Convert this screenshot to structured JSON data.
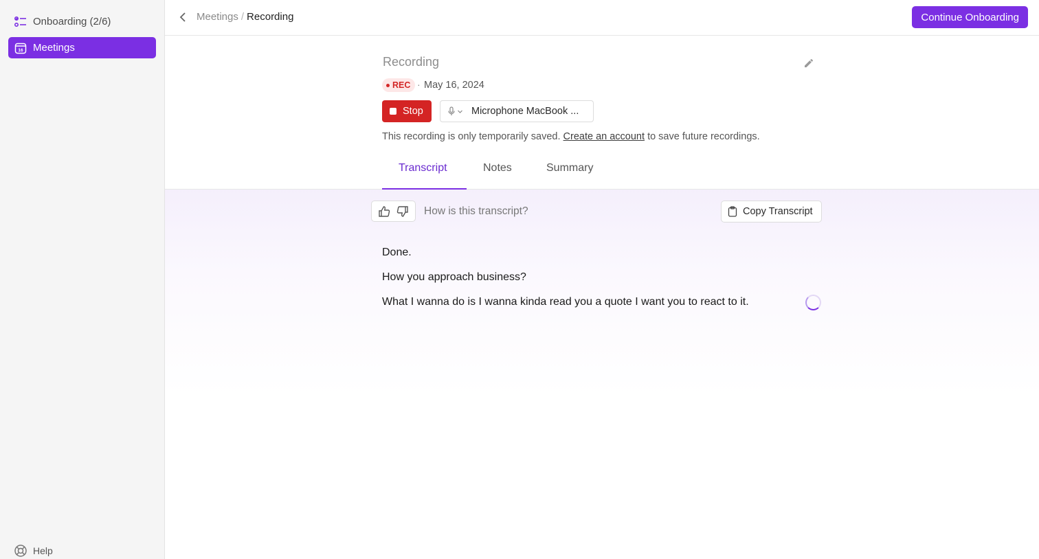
{
  "sidebar": {
    "items": [
      {
        "label": "Onboarding (2/6)",
        "icon": "checklist-icon"
      },
      {
        "label": "Meetings",
        "icon": "calendar-icon",
        "active": true
      }
    ],
    "calendar_day": "16",
    "help_label": "Help"
  },
  "topbar": {
    "breadcrumb_parent": "Meetings",
    "breadcrumb_sep": "/",
    "breadcrumb_current": "Recording",
    "continue_label": "Continue Onboarding"
  },
  "recording": {
    "title": "Recording",
    "badge": "REC",
    "meta_sep": "·",
    "date": "May 16, 2024",
    "stop_label": "Stop",
    "microphone": "Microphone MacBook ...",
    "notice_prefix": "This recording is only temporarily saved.",
    "notice_link": "Create an account",
    "notice_suffix": "to save future recordings."
  },
  "tabs": [
    {
      "label": "Transcript",
      "active": true
    },
    {
      "label": "Notes"
    },
    {
      "label": "Summary"
    }
  ],
  "feedback": {
    "question": "How is this transcript?",
    "copy_label": "Copy Transcript"
  },
  "transcript": {
    "lines": [
      "Done.",
      "How you approach business?",
      "What I wanna do is I wanna kinda read you a quote I want you to react to it."
    ]
  },
  "colors": {
    "accent": "#7b2fe3",
    "stop": "#d42424",
    "rec_badge_bg": "#fde7e7",
    "rec_badge_text": "#d32626"
  }
}
